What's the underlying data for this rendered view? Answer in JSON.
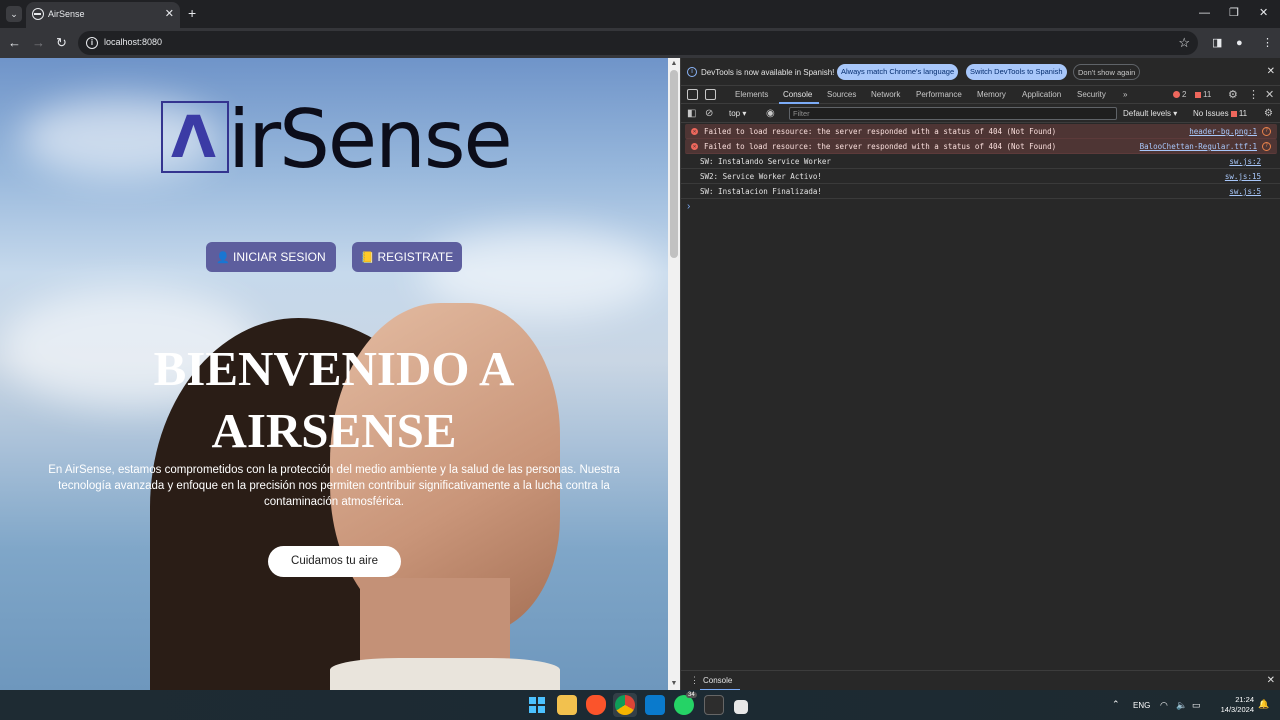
{
  "browser": {
    "tab_title": "AirSense",
    "tab_close": "✕",
    "new_tab": "+",
    "url": "localhost:8080",
    "window_controls": {
      "minimize": "—",
      "maximize": "❐",
      "close": "✕"
    }
  },
  "page": {
    "logo_lambda": "Λ",
    "logo_text": "irSense",
    "login_button": "INICIAR SESION",
    "register_button": "REGISTRATE",
    "hero_title": "BIENVENIDO A AIRSENSE",
    "hero_text": "En AirSense, estamos comprometidos con la protección del medio ambiente y la salud de las personas. Nuestra tecnología avanzada y enfoque en la precisión nos permiten contribuir significativamente a la lucha contra la contaminación atmosférica.",
    "cta_button": "Cuidamos tu aire"
  },
  "devtools": {
    "banner": {
      "text": "DevTools is now available in Spanish!",
      "match_language": "Always match Chrome's language",
      "switch_spanish": "Switch DevTools to Spanish",
      "dont_show": "Don't show again"
    },
    "tabs": [
      "Elements",
      "Console",
      "Sources",
      "Network",
      "Performance",
      "Memory",
      "Application",
      "Security"
    ],
    "more_tabs": "»",
    "error_count": "2",
    "warning_count": "11",
    "context": "top ▾",
    "filter_placeholder": "Filter",
    "levels": "Default levels ▾",
    "issues_label": "No Issues",
    "issues_count": "11",
    "logs": [
      {
        "type": "error",
        "message": "Failed to load resource: the server responded with a status of 404 (Not Found)",
        "source": "header-bg.png:1"
      },
      {
        "type": "error",
        "message": "Failed to load resource: the server responded with a status of 404 (Not Found)",
        "source": "BalooChettan-Regular.ttf:1"
      },
      {
        "type": "info",
        "message": "SW: Instalando Service Worker",
        "source": "sw.js:2"
      },
      {
        "type": "info",
        "message": "SW2: Service Worker Activo!",
        "source": "sw.js:15"
      },
      {
        "type": "info",
        "message": "SW: Instalacion Finalizada!",
        "source": "sw.js:5"
      }
    ],
    "prompt": "›",
    "drawer_tab": "Console"
  },
  "taskbar": {
    "language": "ENG",
    "time": "21:24",
    "date": "14/3/2024",
    "whatsapp_badge": "34"
  },
  "colors": {
    "brand": "#3b3ba5",
    "pill": "#5d5e9e",
    "devtools_bg": "#282828",
    "error_row": "#4e3534",
    "link": "#a8c7fa"
  }
}
